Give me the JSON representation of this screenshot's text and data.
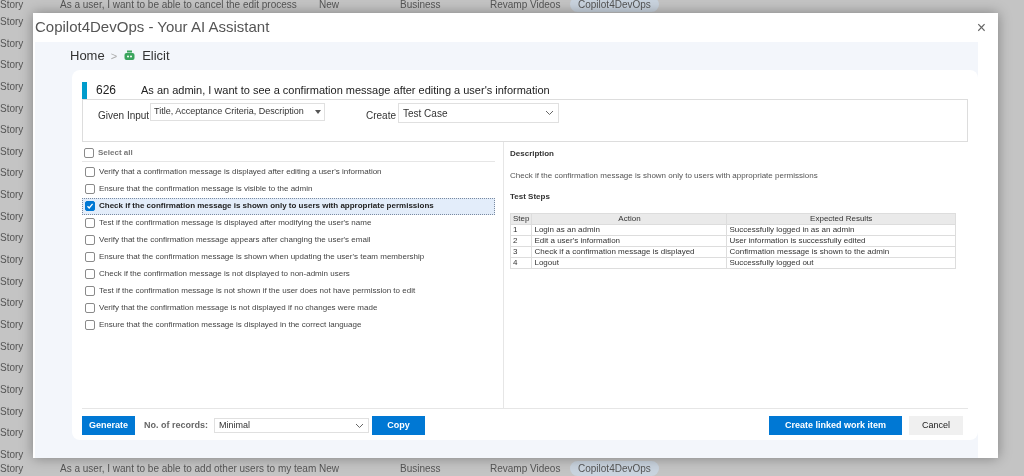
{
  "background_list": {
    "top_row": {
      "type": "Story",
      "title": "As a user, I want to be able to cancel the edit process",
      "state": "New",
      "area": "Business",
      "iteration": "Revamp Videos",
      "tag": "Copilot4DevOps"
    },
    "side_labels": [
      "Story",
      "Story",
      "Story",
      "Story",
      "Story",
      "Story",
      "Story",
      "Story",
      "Story",
      "Story",
      "Story",
      "Story",
      "Story",
      "Story",
      "Story",
      "Story",
      "Story",
      "Story",
      "Story",
      "Story",
      "Story"
    ],
    "bottom_row": {
      "type": "Story",
      "title": "As a user, I want to be able to add other users to my team",
      "state": "New",
      "area": "Business",
      "iteration": "Revamp Videos",
      "tag": "Copilot4DevOps"
    }
  },
  "dialog": {
    "title": "Copilot4DevOps - Your AI Assistant",
    "close": "×"
  },
  "breadcrumb": [
    {
      "label": "Home"
    },
    {
      "label": "Elicit"
    }
  ],
  "breadcrumb_separator": ">",
  "work_item": {
    "id": "626",
    "title": "As an admin, I want to see a confirmation message after editing a user's information"
  },
  "given_input": {
    "label": "Given Input",
    "value": "Title, Acceptance Criteria, Description"
  },
  "create": {
    "label": "Create",
    "value": "Test Case"
  },
  "select_all": {
    "label": "Select all",
    "checked": false
  },
  "test_cases": [
    {
      "label": "Verify that a confirmation message is displayed after editing a user's information",
      "checked": false,
      "selected": false
    },
    {
      "label": "Ensure that the confirmation message is visible to the admin",
      "checked": false,
      "selected": false
    },
    {
      "label": "Check if the confirmation message is shown only to users with appropriate permissions",
      "checked": true,
      "selected": true
    },
    {
      "label": "Test if the confirmation message is displayed after modifying the user's name",
      "checked": false,
      "selected": false
    },
    {
      "label": "Verify that the confirmation message appears after changing the user's email",
      "checked": false,
      "selected": false
    },
    {
      "label": "Ensure that the confirmation message is shown when updating the user's team membership",
      "checked": false,
      "selected": false
    },
    {
      "label": "Check if the confirmation message is not displayed to non-admin users",
      "checked": false,
      "selected": false
    },
    {
      "label": "Test if the confirmation message is not shown if the user does not have permission to edit",
      "checked": false,
      "selected": false
    },
    {
      "label": "Verify that the confirmation message is not displayed if no changes were made",
      "checked": false,
      "selected": false
    },
    {
      "label": "Ensure that the confirmation message is displayed in the correct language",
      "checked": false,
      "selected": false
    }
  ],
  "details": {
    "description_heading": "Description",
    "description": "Check if the confirmation message is shown only to users with appropriate permissions",
    "steps_heading": "Test Steps",
    "table": {
      "columns": [
        "Step",
        "Action",
        "Expected Results"
      ],
      "rows": [
        [
          "1",
          "Login as an admin",
          "Successfully logged in as an admin"
        ],
        [
          "2",
          "Edit a user's information",
          "User information is successfully edited"
        ],
        [
          "3",
          "Check if a confirmation message is displayed",
          "Confirmation message is shown to the admin"
        ],
        [
          "4",
          "Logout",
          "Successfully logged out"
        ]
      ]
    }
  },
  "footer": {
    "generate": "Generate",
    "records_label": "No. of records:",
    "records_value": "Minimal",
    "copy": "Copy",
    "create_linked": "Create linked work item",
    "cancel": "Cancel"
  }
}
